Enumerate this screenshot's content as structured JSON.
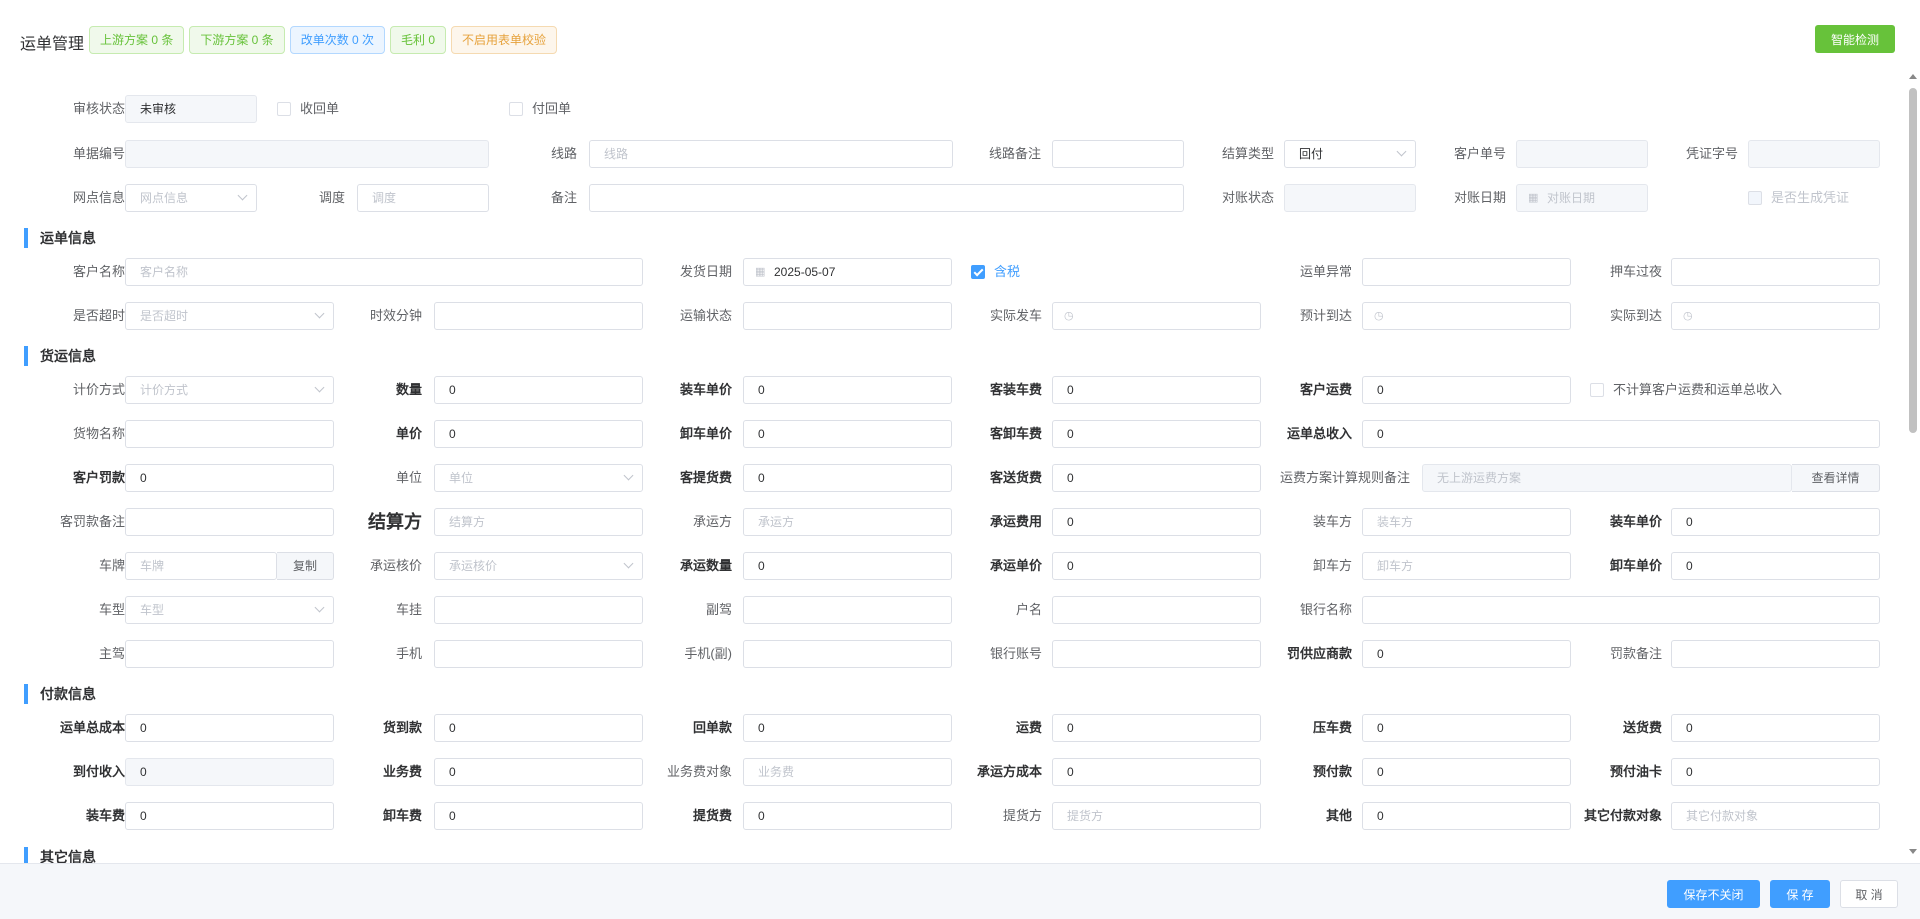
{
  "header": {
    "title": "运单管理",
    "tags": [
      "上游方案 0 条",
      "下游方案 0 条",
      "改单次数 0 次",
      "毛利 0",
      "不启用表单校验"
    ],
    "smart_btn": "智能检测"
  },
  "labels": {
    "shenhe": "审核状态",
    "shouhuidan": "收回单",
    "fuhuidan": "付回单",
    "djbh": "单据编号",
    "xianlu": "线路",
    "xlbz": "线路备注",
    "jslx": "结算类型",
    "khdh": "客户单号",
    "pzzh": "凭证字号",
    "wdxx": "网点信息",
    "diaodu": "调度",
    "beizhu": "备注",
    "dzzt": "对账状态",
    "dzrq": "对账日期",
    "sfscpz": "是否生成凭证",
    "khmc": "客户名称",
    "fhrq": "发货日期",
    "hanshui": "含税",
    "ydyc": "运单异常",
    "yacheguoye": "押车过夜",
    "sfcs": "是否超时",
    "sxfz": "时效分钟",
    "yszt": "运输状态",
    "sjfc": "实际发车",
    "yjdd": "预计到达",
    "sjdd": "实际到达",
    "jjfs": "计价方式",
    "shuliang": "数量",
    "zcdj": "装车单价",
    "kzcf": "客装车费",
    "khyf": "客户运费",
    "bjs": "不计算客户运费和运单总收入",
    "hwmc": "货物名称",
    "danjia": "单价",
    "xcdj": "卸车单价",
    "kxcf": "客卸车费",
    "ydzsr": "运单总收入",
    "khfk": "客户罚款",
    "danwei": "单位",
    "kthf": "客提货费",
    "ksf": "客送货费",
    "yffa": "运费方案计算规则备注",
    "kfkbz": "客罚款备注",
    "jsf": "结算方",
    "cyf": "承运方",
    "cyfy": "承运费用",
    "zcf_party": "装车方",
    "zcdj2": "装车单价",
    "chepai": "车牌",
    "fuzhi": "复制",
    "cyhj": "承运核价",
    "cysl": "承运数量",
    "cydj": "承运单价",
    "xcf_party": "卸车方",
    "xcdj2": "卸车单价",
    "chexing": "车型",
    "chegua": "车挂",
    "fujia": "副驾",
    "huming": "户名",
    "yhmc": "银行名称",
    "zhujia": "主驾",
    "shouji": "手机",
    "shoujifu": "手机(副)",
    "yhzh": "银行账号",
    "fgysk": "罚供应商款",
    "fkbz": "罚款备注",
    "ydzcb": "运单总成本",
    "hdk": "货到款",
    "hdk2": "回单款",
    "yunfei": "运费",
    "yachefei": "压车费",
    "shf": "送货费",
    "dfsr": "到付收入",
    "ywf": "业务费",
    "ywfdx": "业务费对象",
    "cyfcb": "承运方成本",
    "yfk": "预付款",
    "yfyk": "预付油卡",
    "zcf": "装车费",
    "xcf": "卸车费",
    "thf": "提货费",
    "thf_party": "提货方",
    "qita": "其他",
    "qtfkdx": "其它付款对象",
    "ckxq": "查看详情"
  },
  "values": {
    "shenhe": "未审核",
    "jslx": "回付",
    "fhrq": "2025-05-07",
    "zero": "0"
  },
  "placeholders": {
    "xianlu": "线路",
    "wdxx": "网点信息",
    "diaodu": "调度",
    "dzrq": "对账日期",
    "khmc": "客户名称",
    "sfcs": "是否超时",
    "jjfs": "计价方式",
    "danwei": "单位",
    "yffa": "无上游运费方案",
    "jsf": "结算方",
    "cyf": "承运方",
    "zcf": "装车方",
    "chepai": "车牌",
    "cyhj": "承运核价",
    "xcf": "卸车方",
    "chexing": "车型",
    "ywf": "业务费",
    "thf": "提货方",
    "qtfkdx": "其它付款对象"
  },
  "sections": {
    "yundan": "运单信息",
    "huoyun": "货运信息",
    "fukuan": "付款信息",
    "qita": "其它信息"
  },
  "checkboxes": {
    "shouhuidan": false,
    "fuhuidan": false,
    "hanshui": true,
    "bjs": false,
    "sfscpz": false
  },
  "footer": {
    "save_noclose": "保存不关闭",
    "save": "保 存",
    "cancel": "取 消"
  },
  "colors": {
    "primary": "#409eff",
    "success": "#67c23a",
    "warning": "#e6a23c"
  }
}
